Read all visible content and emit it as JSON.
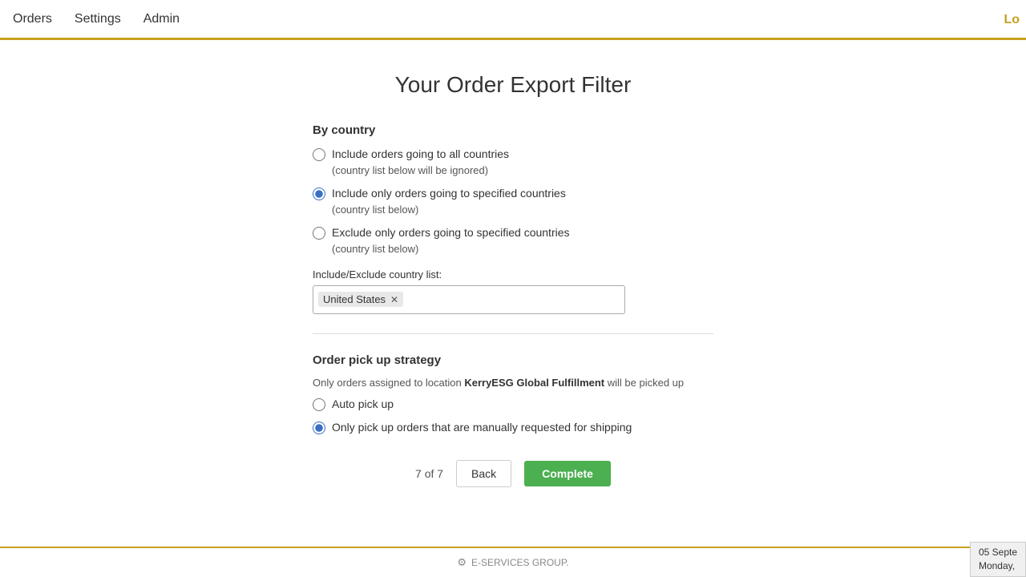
{
  "nav": {
    "items": [
      {
        "label": "Orders",
        "id": "orders"
      },
      {
        "label": "Settings",
        "id": "settings"
      },
      {
        "label": "Admin",
        "id": "admin"
      }
    ],
    "right_label": "Lo"
  },
  "page": {
    "title": "Your Order Export Filter",
    "sections": {
      "by_country": {
        "heading": "By country",
        "options": [
          {
            "id": "all_countries",
            "label": "Include orders going to all countries",
            "sublabel": "(country list below will be ignored)",
            "checked": false
          },
          {
            "id": "include_specified",
            "label": "Include only orders going to specified countries",
            "sublabel": "(country list below)",
            "checked": true
          },
          {
            "id": "exclude_specified",
            "label": "Exclude only orders going to specified countries",
            "sublabel": "(country list below)",
            "checked": false
          }
        ],
        "country_list_label": "Include/Exclude country list:",
        "country_tags": [
          "United States"
        ]
      },
      "pickup_strategy": {
        "heading": "Order pick up strategy",
        "subtext_prefix": "Only orders assigned to location ",
        "location_bold": "KerryESG Global Fulfillment",
        "subtext_suffix": " will be picked up",
        "options": [
          {
            "id": "auto_pickup",
            "label": "Auto pick up",
            "checked": false
          },
          {
            "id": "manual_pickup",
            "label": "Only pick up orders that are manually requested for shipping",
            "checked": true
          }
        ]
      }
    },
    "pagination": {
      "current": 7,
      "total": 7,
      "label": "7 of 7"
    },
    "buttons": {
      "back": "Back",
      "complete": "Complete"
    }
  },
  "footer": {
    "label": "E-SERVICES GROUP."
  },
  "date_overlay": {
    "line1": "05 Septe",
    "line2": "Monday,"
  }
}
